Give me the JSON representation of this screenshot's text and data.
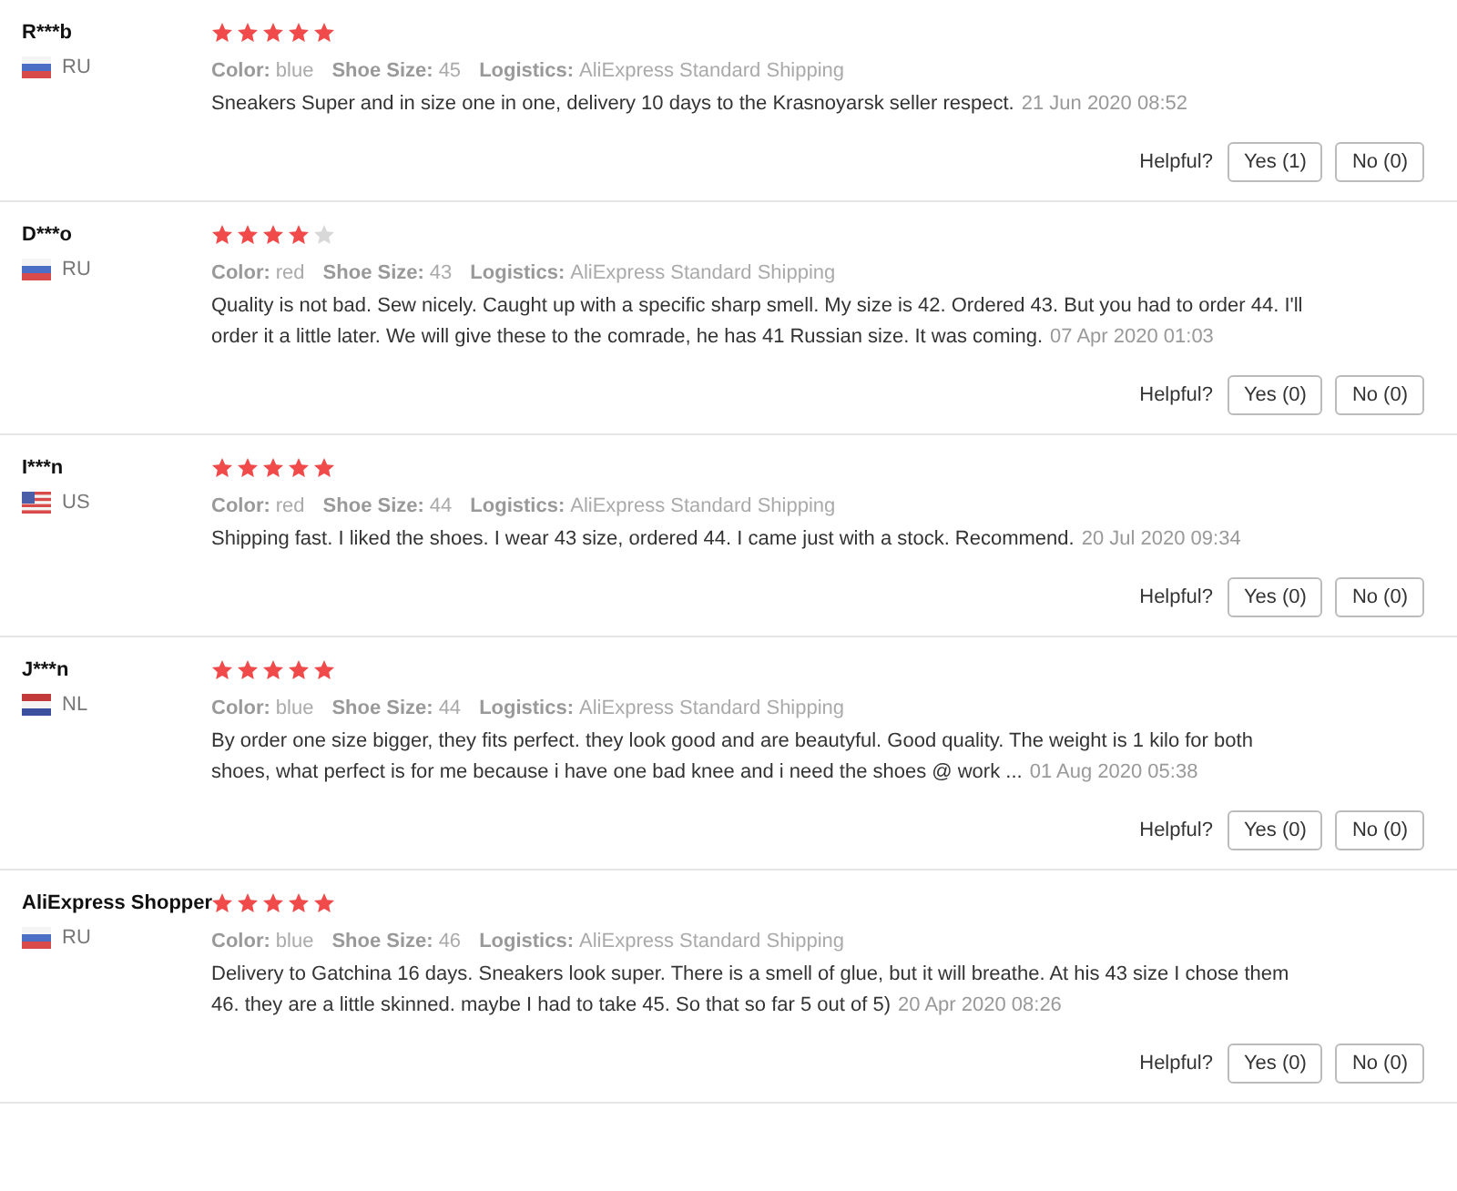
{
  "reviews": [
    {
      "name": "R***b",
      "kind": "ru",
      "country": "RU",
      "stars": 5,
      "attributes": [
        {
          "label": "Color:",
          "value": "blue"
        },
        {
          "label": "Shoe Size:",
          "value": "45"
        },
        {
          "label": "Logistics:",
          "value": "AliExpress Standard Shipping"
        }
      ],
      "text": "Sneakers Super and in size one in one, delivery 10 days to the Krasnoyarsk seller respect.",
      "date": "21 Jun 2020 08:52",
      "helpful_label": "Helpful?",
      "yes": "Yes (1)",
      "no": "No (0)"
    },
    {
      "name": "D***o",
      "kind": "ru",
      "country": "RU",
      "stars": 4,
      "attributes": [
        {
          "label": "Color:",
          "value": "red"
        },
        {
          "label": "Shoe Size:",
          "value": "43"
        },
        {
          "label": "Logistics:",
          "value": "AliExpress Standard Shipping"
        }
      ],
      "text": "Quality is not bad. Sew nicely. Caught up with a specific sharp smell. My size is 42. Ordered 43. But you had to order 44. I'll order it a little later. We will give these to the comrade, he has 41 Russian size. It was coming.",
      "date": "07 Apr 2020 01:03",
      "helpful_label": "Helpful?",
      "yes": "Yes (0)",
      "no": "No (0)"
    },
    {
      "name": "I***n",
      "kind": "us",
      "country": "US",
      "stars": 5,
      "attributes": [
        {
          "label": "Color:",
          "value": "red"
        },
        {
          "label": "Shoe Size:",
          "value": "44"
        },
        {
          "label": "Logistics:",
          "value": "AliExpress Standard Shipping"
        }
      ],
      "text": "Shipping fast. I liked the shoes. I wear 43 size, ordered 44. I came just with a stock. Recommend.",
      "date": "20 Jul 2020 09:34",
      "helpful_label": "Helpful?",
      "yes": "Yes (0)",
      "no": "No (0)"
    },
    {
      "name": "J***n",
      "kind": "nl",
      "country": "NL",
      "stars": 5,
      "attributes": [
        {
          "label": "Color:",
          "value": "blue"
        },
        {
          "label": "Shoe Size:",
          "value": "44"
        },
        {
          "label": "Logistics:",
          "value": "AliExpress Standard Shipping"
        }
      ],
      "text": "By order one size bigger, they fits perfect. they look good and are beautyful. Good quality. The weight is 1 kilo for both shoes, what perfect is for me because i have one bad knee and i need the shoes @ work ...",
      "date": "01 Aug 2020 05:38",
      "helpful_label": "Helpful?",
      "yes": "Yes (0)",
      "no": "No (0)"
    },
    {
      "name": "AliExpress Shopper",
      "kind": "ru",
      "country": "RU",
      "stars": 5,
      "attributes": [
        {
          "label": "Color:",
          "value": "blue"
        },
        {
          "label": "Shoe Size:",
          "value": "46"
        },
        {
          "label": "Logistics:",
          "value": "AliExpress Standard Shipping"
        }
      ],
      "text": "Delivery to Gatchina 16 days. Sneakers look super. There is a smell of glue, but it will breathe. At his 43 size I chose them 46. they are a little skinned. maybe I had to take 45. So that so far 5 out of 5)",
      "date": "20 Apr 2020 08:26",
      "helpful_label": "Helpful?",
      "yes": "Yes (0)",
      "no": "No (0)"
    }
  ]
}
